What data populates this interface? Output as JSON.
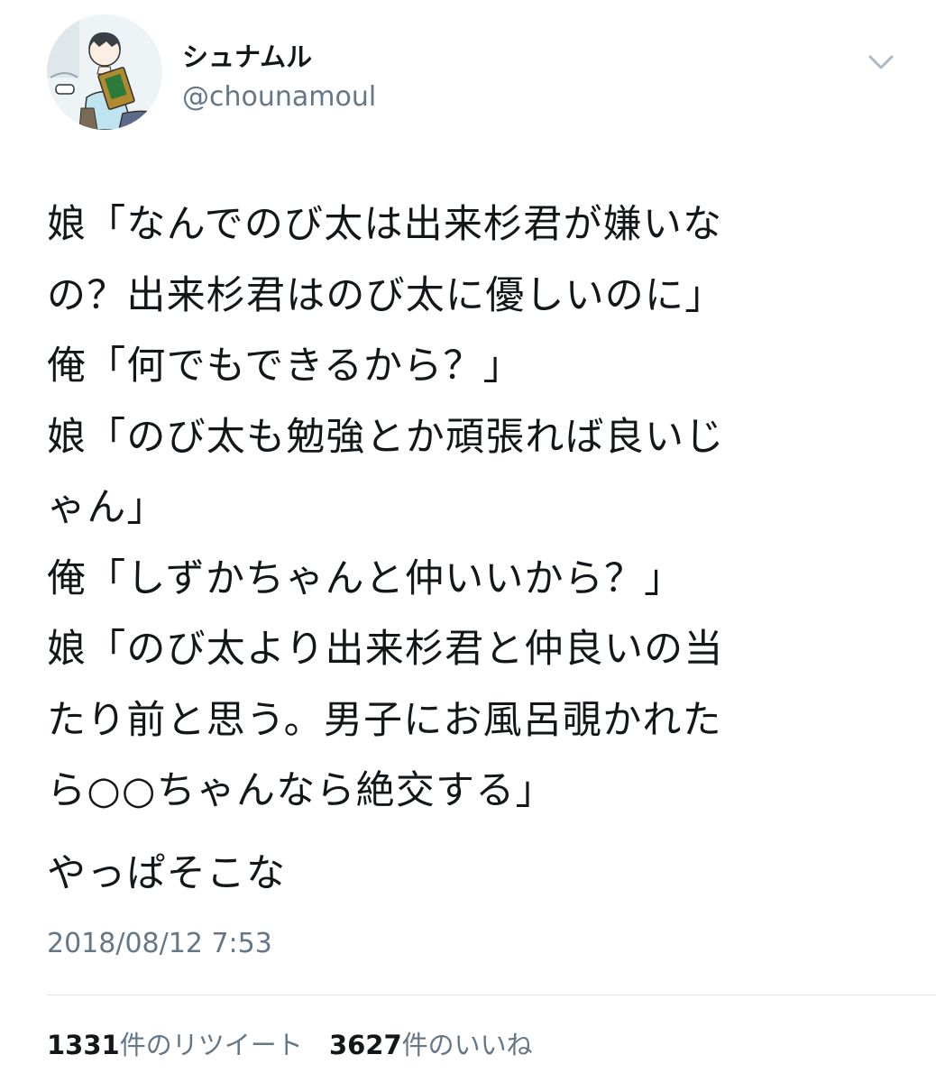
{
  "author": {
    "display_name": "シュナムル",
    "handle": "@chounamoul",
    "avatar_caption": "@chounamoul"
  },
  "tweet": {
    "lines": [
      "娘「なんでのび太は出来杉君が嫌いな",
      "の？出来杉君はのび太に優しいのに」",
      "俺「何でもできるから？」",
      "娘「のび太も勉強とか頑張れば良いじ",
      "ゃん」",
      "俺「しずかちゃんと仲いいから？」",
      "娘「のび太より出来杉君と仲良いの当",
      "たり前と思う。男子にお風呂覗かれた",
      "ら○○ちゃんなら絶交する」"
    ],
    "closing": "やっぱそこな",
    "timestamp": "2018/08/12 7:53"
  },
  "stats": {
    "retweets": {
      "count": "1331",
      "label": "件のリツイート"
    },
    "likes": {
      "count": "3627",
      "label": "件のいいね"
    }
  },
  "icons": {
    "menu": "chevron-down-icon",
    "avatar": "avatar-illustration"
  },
  "colors": {
    "text": "#14171a",
    "secondary": "#657786",
    "divider": "#dfe4e8"
  }
}
